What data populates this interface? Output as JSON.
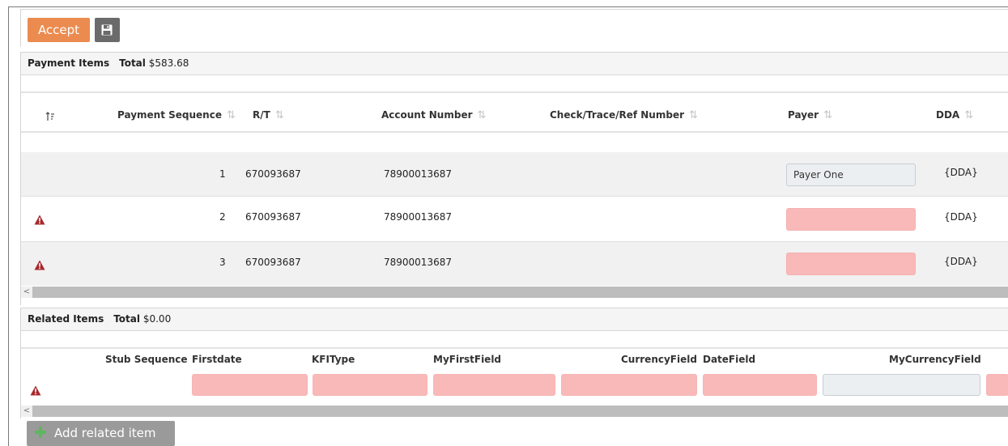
{
  "toolbar": {
    "accept_label": "Accept",
    "save_icon": "floppy-disk-icon"
  },
  "payment_items": {
    "title": "Payment Items",
    "total_label": "Total",
    "total_value": "$583.68",
    "columns": [
      "Payment Sequence",
      "R/T",
      "Account Number",
      "Check/Trace/Ref Number",
      "Payer",
      "DDA"
    ],
    "rows": [
      {
        "seq": "1",
        "rt": "670093687",
        "account": "78900013687",
        "check": "",
        "payer": "Payer One",
        "dda": "{DDA}",
        "warning": false
      },
      {
        "seq": "2",
        "rt": "670093687",
        "account": "78900013687",
        "check": "",
        "payer": "",
        "dda": "{DDA}",
        "warning": true
      },
      {
        "seq": "3",
        "rt": "670093687",
        "account": "78900013687",
        "check": "",
        "payer": "",
        "dda": "{DDA}",
        "warning": true
      }
    ]
  },
  "related_items": {
    "title": "Related Items",
    "total_label": "Total",
    "total_value": "$0.00",
    "columns": [
      "Stub Sequence",
      "Firstdate",
      "KFIType",
      "MyFirstField",
      "CurrencyField",
      "DateField",
      "MyCurrencyField"
    ]
  },
  "add_related_label": "Add related item",
  "colors": {
    "accent": "#ec8b4f",
    "error_field": "#f9b9b9",
    "warning_icon": "#a8282c"
  }
}
